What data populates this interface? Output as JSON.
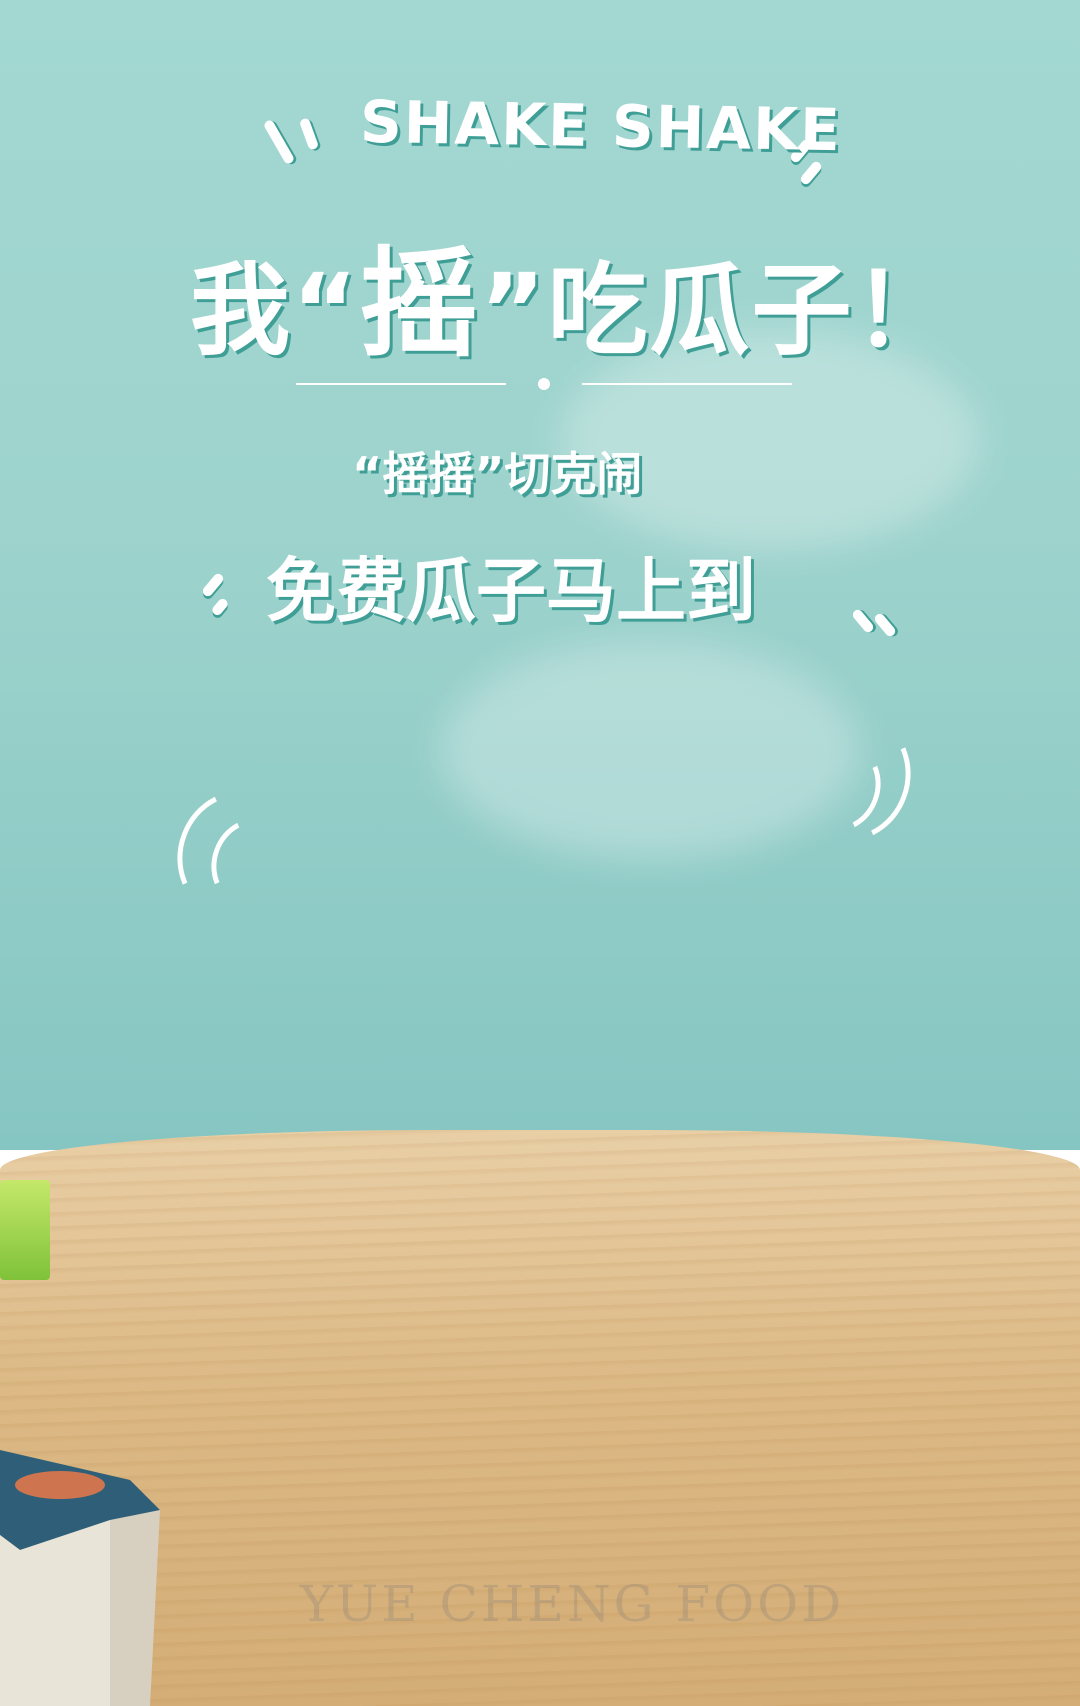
{
  "poster": {
    "title_en": "SHAKE SHAKE",
    "title_cn_prefix": "我",
    "title_cn_open_quote": "“",
    "title_cn_big": "摇",
    "title_cn_close_quote": "”",
    "title_cn_suffix": "吃瓜子！",
    "subtitle_1": "“摇摇”切克闹",
    "subtitle_2": "免费瓜子马上到",
    "watermark": "YUE CHENG FOOD"
  },
  "colors": {
    "sky": "#a3d8d2",
    "text": "#ffffff",
    "text_shadow": "#3f9f96",
    "table": "#dcb985"
  }
}
